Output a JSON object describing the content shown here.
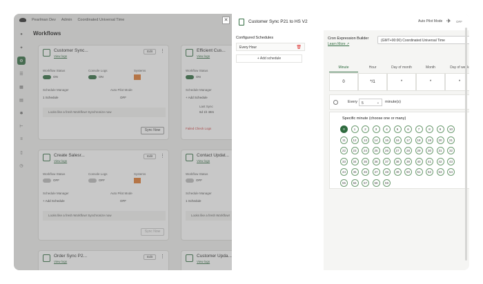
{
  "app": {
    "topbar": {
      "workspace": "Pearlman Dev",
      "user": "Admin",
      "timezone_label": "Coordinated Universal Time"
    },
    "page_title": "Workflows",
    "close_glyph": "✕"
  },
  "cards": [
    {
      "title": "Customer Sync...",
      "link": "View logs",
      "edit": "Edit",
      "status_label": "Workflow Status",
      "status": "ON",
      "console_label": "Console Logs",
      "console": "ON",
      "systems_label": "Systems",
      "schedule_label": "Schedule Manager",
      "schedule_value": "1 Schedule",
      "pilot_label": "Auto Pilot Mode",
      "pilot_value": "OFF",
      "message": "Looks like a fresh Workflow! Synchronize now",
      "sync": "Sync Now"
    },
    {
      "title": "Efficient Cus...",
      "link": "View logs",
      "status_label": "Workflow Status",
      "status": "ON",
      "console_label": "Console Logs",
      "console": "ON",
      "schedule_label": "Schedule Manager",
      "schedule_value": "+ Add Schedule",
      "last_sync_label": "Last Sync",
      "last_sync_value": "6d 1h 48m",
      "failed": "Failed Check Logs"
    },
    {
      "title": "Create Salesr...",
      "link": "View logs",
      "edit": "Edit",
      "status_label": "Workflow Status",
      "status": "OFF",
      "console_label": "Console Logs",
      "console": "OFF",
      "systems_label": "Systems",
      "schedule_label": "Schedule Manager",
      "schedule_value": "+ Add Schedule",
      "pilot_label": "Auto Pilot Mode",
      "pilot_value": "OFF",
      "message": "Looks like a fresh Workflow! Synchronize now",
      "sync": "Sync Now"
    },
    {
      "title": "Contact Updat...",
      "link": "View logs",
      "status_label": "Workflow Status",
      "status": "OFF",
      "console_label": "Console Logs",
      "console": "OFF",
      "schedule_label": "Schedule Manager",
      "schedule_value": "1 Schedule",
      "message": "Looks like a fresh Workflow!"
    },
    {
      "title": "Order Sync P2...",
      "link": "View logs",
      "edit": "Edit"
    },
    {
      "title": "Customer Upda...",
      "link": "View logs"
    }
  ],
  "drawer": {
    "title": "Customer Sync P21 to HS V2",
    "auto_pilot_label": "Auto Pilot Mode",
    "auto_pilot_value": "OFF",
    "schedules_heading": "Configured Schedules",
    "schedule_item": "Every Hour",
    "add_schedule": "+ Add schedule",
    "cron": {
      "heading": "Cron Expression Builder",
      "learn_more": "Learn More",
      "timezone": "(GMT+00:00) Coordinated Universal Time",
      "tabs": [
        "Minute",
        "Hour",
        "Day of month",
        "Month",
        "Day of week"
      ],
      "fields": [
        "0",
        "*/1",
        "*",
        "*",
        "*"
      ],
      "every_label": "Every",
      "every_value": "5",
      "every_unit": "minute(s)",
      "specific_label": "Specific minute (choose one or many)",
      "selected_minute": "0",
      "minutes": [
        "0",
        "1",
        "2",
        "3",
        "4",
        "5",
        "6",
        "7",
        "8",
        "9",
        "10",
        "11",
        "12",
        "13",
        "14",
        "15",
        "16",
        "17",
        "18",
        "19",
        "20",
        "21",
        "22",
        "23",
        "24",
        "25",
        "26",
        "27",
        "28",
        "29",
        "30",
        "31",
        "32",
        "33",
        "34",
        "35",
        "36",
        "37",
        "38",
        "39",
        "40",
        "41",
        "42",
        "43",
        "44",
        "45",
        "46",
        "47",
        "48",
        "49",
        "50",
        "51",
        "52",
        "53",
        "54",
        "55",
        "56",
        "57",
        "58",
        "59"
      ]
    }
  }
}
